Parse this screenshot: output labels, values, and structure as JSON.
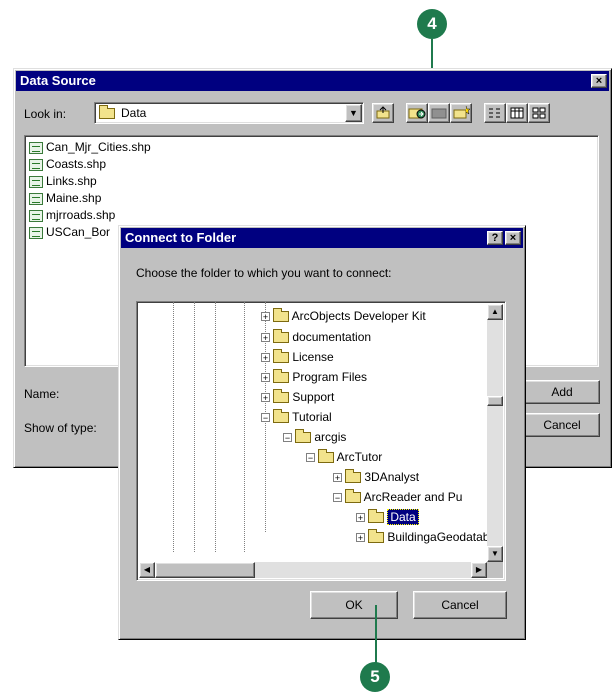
{
  "callouts": {
    "top": "4",
    "bottom": "5"
  },
  "data_source": {
    "title": "Data Source",
    "close_glyph": "×",
    "look_in_label": "Look in:",
    "look_in_value": "Data",
    "files": [
      {
        "name": "Can_Mjr_Cities.shp"
      },
      {
        "name": "Coasts.shp"
      },
      {
        "name": "Links.shp"
      },
      {
        "name": "Maine.shp"
      },
      {
        "name": "mjrroads.shp"
      },
      {
        "name": "USCan_Bor"
      }
    ],
    "name_label": "Name:",
    "type_label": "Show of type:",
    "add_label": "Add",
    "cancel_label": "Cancel"
  },
  "connect": {
    "title": "Connect to Folder",
    "help_glyph": "?",
    "close_glyph": "×",
    "prompt": "Choose the folder to which you want to connect:",
    "tree": [
      {
        "label": "ArcObjects Developer Kit",
        "toggle": "+"
      },
      {
        "label": "documentation",
        "toggle": "+"
      },
      {
        "label": "License",
        "toggle": "+"
      },
      {
        "label": "Program Files",
        "toggle": "+"
      },
      {
        "label": "Support",
        "toggle": "+"
      },
      {
        "label": "Tutorial",
        "toggle": "−"
      },
      {
        "label": "arcgis",
        "toggle": "−"
      },
      {
        "label": "ArcTutor",
        "toggle": "−"
      },
      {
        "label": "3DAnalyst",
        "toggle": "+"
      },
      {
        "label": "ArcReader and Pu",
        "toggle": "−"
      },
      {
        "label": "Data",
        "toggle": "+"
      },
      {
        "label": "BuildingaGeodatab",
        "toggle": "+"
      }
    ],
    "ok_label": "OK",
    "cancel_label": "Cancel"
  },
  "colors": {
    "titlebar": "#000080",
    "callout": "#1f7a4d",
    "face": "#c0c0c0"
  }
}
